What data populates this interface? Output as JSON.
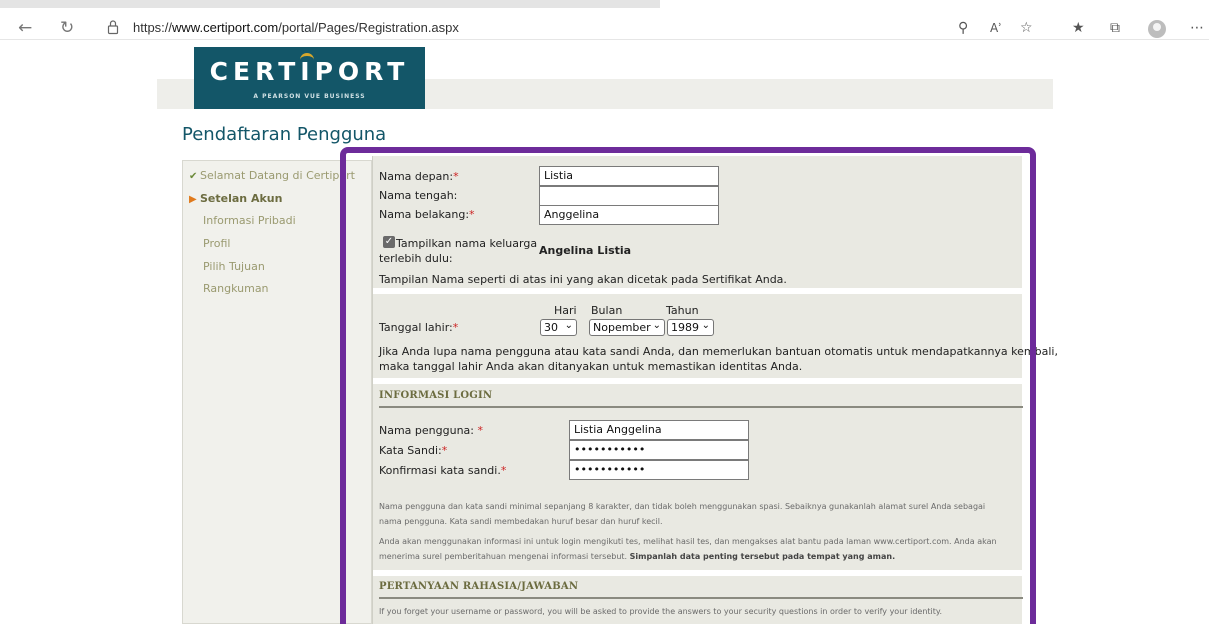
{
  "browser": {
    "url_prefix": "https://",
    "url_host": "www.certiport.com",
    "url_path": "/portal/Pages/Registration.aspx"
  },
  "logo": {
    "name": "CERTIPORT",
    "tagline": "A PEARSON VUE BUSINESS"
  },
  "page_title": "Pendaftaran Pengguna",
  "sidebar": {
    "items": [
      {
        "label": "Selamat Datang di Certiport",
        "state": "done"
      },
      {
        "label": "Setelan Akun",
        "state": "active"
      },
      {
        "label": "Informasi Pribadi",
        "state": "pending"
      },
      {
        "label": "Profil",
        "state": "pending"
      },
      {
        "label": "Pilih Tujuan",
        "state": "pending"
      },
      {
        "label": "Rangkuman",
        "state": "pending"
      }
    ]
  },
  "name_section": {
    "first_label": "Nama depan:",
    "first_value": "Listia",
    "middle_label": "Nama tengah:",
    "middle_value": "",
    "last_label": "Nama belakang:",
    "last_value": "Anggelina",
    "surname_first_label_1": "Tampilkan nama keluarga",
    "surname_first_label_2": "terlebih dulu:",
    "surname_first_checked": true,
    "display_name": "Angelina Listia",
    "display_note": "Tampilan Nama seperti di atas ini yang akan dicetak pada Sertifikat Anda."
  },
  "dob_section": {
    "day_header": "Hari",
    "month_header": "Bulan",
    "year_header": "Tahun",
    "label": "Tanggal lahir:",
    "day_value": "30",
    "month_value": "Nopember",
    "year_value": "1989",
    "note_line1": "Jika Anda lupa nama pengguna atau kata sandi Anda, dan memerlukan bantuan otomatis untuk mendapatkannya kembali,",
    "note_line2": "maka tanggal lahir Anda akan ditanyakan untuk memastikan identitas Anda."
  },
  "login_section": {
    "heading": "INFORMASI LOGIN",
    "username_label": "Nama pengguna:",
    "username_value": "Listia Anggelina",
    "password_label": "Kata Sandi:",
    "password_value": "•••••••••••",
    "confirm_label": "Konfirmasi kata sandi.",
    "confirm_value": "•••••••••••",
    "note1_line1": "Nama pengguna dan kata sandi minimal sepanjang 8 karakter, dan tidak boleh menggunakan spasi. Sebaiknya gunakanlah alamat surel Anda sebagai",
    "note1_line2": "nama pengguna. Kata sandi membedakan huruf besar dan huruf kecil.",
    "note2_line1": "Anda akan menggunakan informasi ini untuk login mengikuti tes, melihat hasil tes, dan mengakses alat bantu pada laman www.certiport.com. Anda akan",
    "note2_line2": "menerima surel pemberitahuan mengenai informasi tersebut.",
    "note2_bold": "Simpanlah data penting tersebut pada tempat yang aman."
  },
  "security_section": {
    "heading": "PERTANYAAN RAHASIA/JAWABAN",
    "note": "If you forget your username or password, you will be asked to provide the answers to your security questions in order to verify your identity."
  },
  "colors": {
    "brand": "#135668",
    "highlight_frame": "#6d2b9a",
    "section_text": "#6c6c40",
    "required": "#cc2222"
  }
}
